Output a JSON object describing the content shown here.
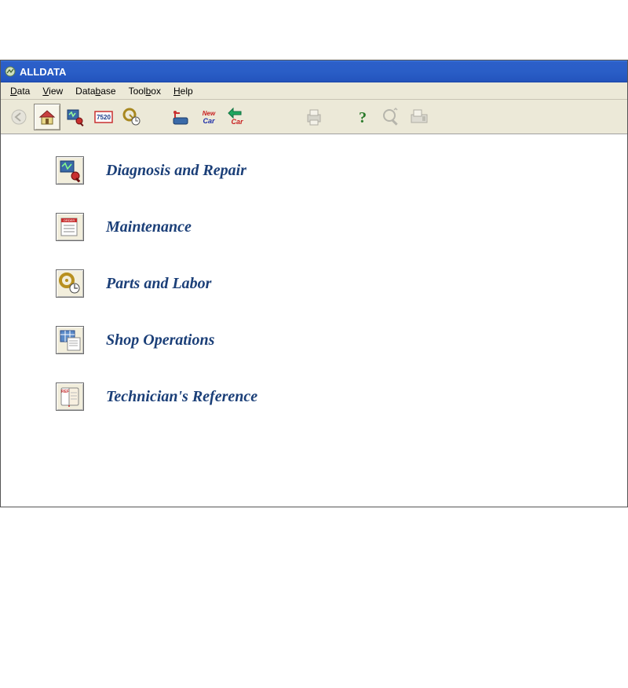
{
  "window": {
    "title": "ALLDATA"
  },
  "menu": {
    "items": [
      {
        "label": "Data",
        "ul_index": 0
      },
      {
        "label": "View",
        "ul_index": 0
      },
      {
        "label": "Database",
        "ul_index": 4
      },
      {
        "label": "Toolbox",
        "ul_index": 4
      },
      {
        "label": "Help",
        "ul_index": 0
      }
    ]
  },
  "toolbar": {
    "items": [
      {
        "name": "back-icon",
        "disabled": true
      },
      {
        "name": "home-icon",
        "selected": true
      },
      {
        "name": "diagnosis-icon"
      },
      {
        "name": "code-7520-icon"
      },
      {
        "name": "parts-labor-icon"
      },
      {
        "gap": true
      },
      {
        "name": "maintenance-icon"
      },
      {
        "name": "new-car-icon"
      },
      {
        "name": "prev-car-icon"
      },
      {
        "gap_lg": true
      },
      {
        "name": "print-icon",
        "disabled": true
      },
      {
        "gap": true
      },
      {
        "name": "help-icon"
      },
      {
        "name": "zoom-icon",
        "disabled": true
      },
      {
        "name": "fax-icon",
        "disabled": true
      }
    ]
  },
  "categories": [
    {
      "icon": "diag-repair-icon",
      "label": "Diagnosis and Repair"
    },
    {
      "icon": "maintenance-icon",
      "label": "Maintenance"
    },
    {
      "icon": "parts-labor-icon",
      "label": "Parts and Labor"
    },
    {
      "icon": "shop-ops-icon",
      "label": "Shop Operations"
    },
    {
      "icon": "tech-ref-icon",
      "label": "Technician's Reference"
    }
  ]
}
